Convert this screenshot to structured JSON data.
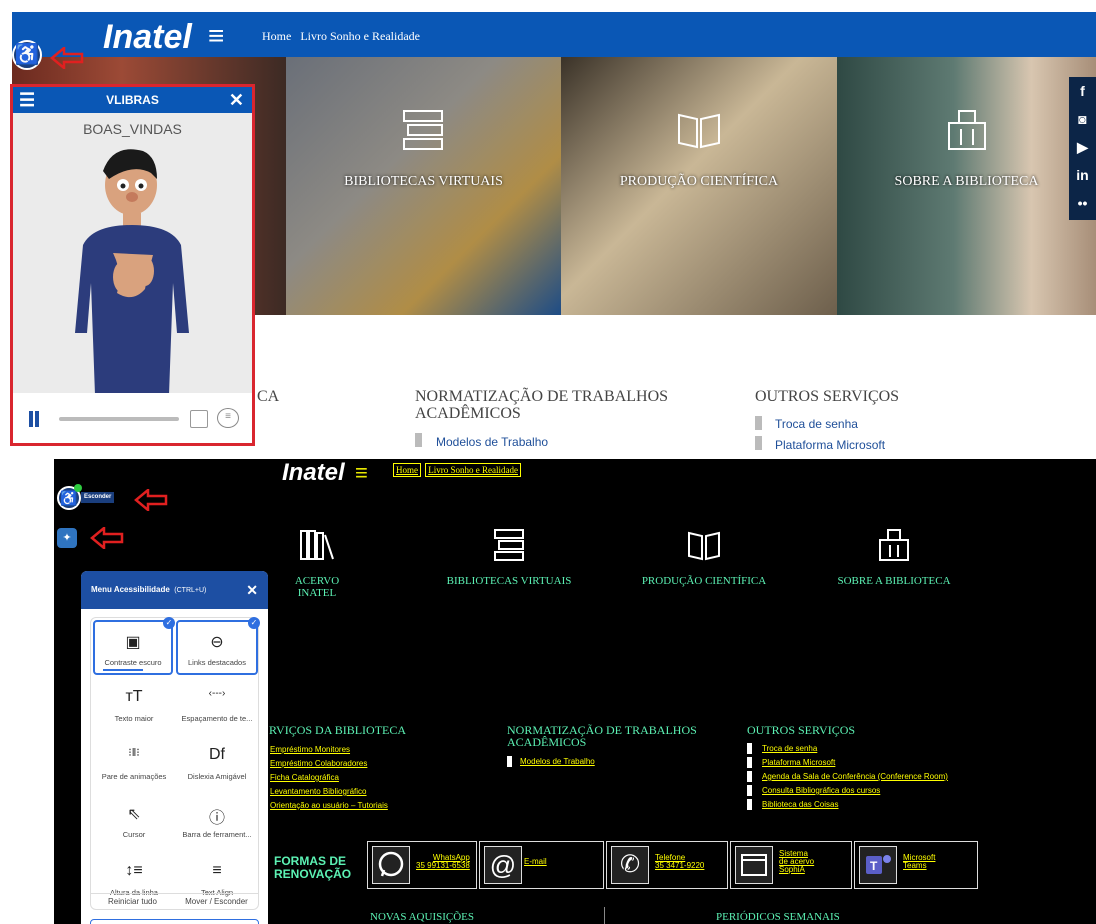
{
  "top": {
    "brand": "Inatel",
    "nav": [
      "Home",
      "Livro Sonho e Realidade"
    ],
    "tiles": [
      "BIBLIOTECAS VIRTUAIS",
      "PRODUÇÃO CIENTÍFICA",
      "SOBRE A BIBLIOTECA"
    ],
    "social_icons": [
      "facebook-icon",
      "instagram-icon",
      "youtube-icon",
      "linkedin-icon",
      "flickr-icon"
    ],
    "partial_heading": "CA",
    "section_normatizacao": {
      "title_line1": "NORMATIZAÇÃO DE TRABALHOS",
      "title_line2": "ACADÊMICOS",
      "items": [
        "Modelos de Trabalho"
      ]
    },
    "section_outros": {
      "title": "OUTROS SERVIÇOS",
      "items": [
        "Troca de senha",
        "Plataforma Microsoft"
      ]
    },
    "vlibras": {
      "title": "VLIBRAS",
      "word": "BOAS_VINDAS"
    }
  },
  "bottom": {
    "brand": "Inatel",
    "nav": [
      "Home",
      "Livro Sonho e Realidade"
    ],
    "hide_label": "Esconder",
    "tiles": [
      "ACERVO INATEL",
      "BIBLIOTECAS VIRTUAIS",
      "PRODUÇÃO CIENTÍFICA",
      "SOBRE A BIBLIOTECA"
    ],
    "section_servicos": {
      "title": "RVIÇOS DA BIBLIOTECA",
      "items": [
        "Empréstimo Monitores",
        "Empréstimo Colaboradores",
        "Ficha Catalográfica",
        "Levantamento Bibliográfico",
        "Orientação ao usuário – Tutoriais"
      ]
    },
    "section_normatizacao": {
      "title_line1": "NORMATIZAÇÃO DE TRABALHOS",
      "title_line2": "ACADÊMICOS",
      "items": [
        "Modelos de Trabalho"
      ]
    },
    "section_outros": {
      "title": "OUTROS SERVIÇOS",
      "items": [
        "Troca de senha",
        "Plataforma Microsoft",
        "Agenda da Sala de Conferência (Conference Room)",
        "Consulta Bibliográfica dos cursos",
        "Biblioteca das Coisas"
      ]
    },
    "formas": {
      "title_line1": "FORMAS DE",
      "title_line2": "RENOVAÇÃO",
      "whatsapp_l1": "WhatsApp",
      "whatsapp_l2": "35 99131-6538",
      "email": "E-mail",
      "phone_l1": "Telefone",
      "phone_l2": "35 3471-9220",
      "sistema_l1": "Sistema",
      "sistema_l2": "de acervo",
      "sistema_l3": "SophiA",
      "teams_l1": "Microsoft",
      "teams_l2": "Teams"
    },
    "footer_titles": [
      "NOVAS AQUISIÇÕES",
      "PERIÓDICOS SEMANAIS"
    ],
    "access_menu": {
      "title": "Menu Acessibilidade",
      "shortcut": "(CTRL+U)",
      "options": [
        "Contraste escuro",
        "Links destacados",
        "Texto maior",
        "Espaçamento de te...",
        "Pare de animações",
        "Dislexia Amigável",
        "Cursor",
        "Barra de ferrament...",
        "Altura da linha",
        "Text Align"
      ],
      "glyphs": [
        "▣",
        "⊖",
        "тT",
        "‹---›",
        "⁝‖⁝",
        "Df",
        "⇖",
        "ⓘ",
        "↕≡",
        "≡"
      ],
      "footer": [
        "Reiniciar tudo",
        "Mover / Esconder"
      ]
    }
  }
}
